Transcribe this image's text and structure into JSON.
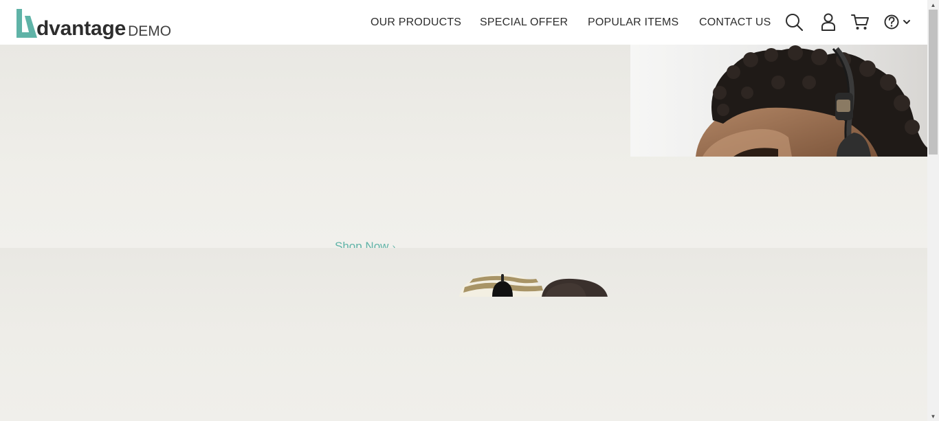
{
  "logo": {
    "word": "dvantage",
    "suffix": "DEMO",
    "mark_icon": "advantage-a-logo",
    "brand_color": "#5fb3a7"
  },
  "nav": {
    "items": [
      {
        "label": "OUR PRODUCTS"
      },
      {
        "label": "SPECIAL OFFER"
      },
      {
        "label": "POPULAR ITEMS"
      },
      {
        "label": "CONTACT US"
      }
    ],
    "icons": [
      "search-icon",
      "user-icon",
      "cart-icon",
      "help-icon",
      "chevron-down-icon"
    ]
  },
  "hero": {
    "cta_label": "Shop Now",
    "cta_icon": "chevron-right-icon",
    "cta_color": "#5fb3a7",
    "image": "man-with-headphones-photo"
  },
  "lower": {
    "image": "wireless-mice-photo"
  },
  "scrollbar": {
    "up_icon": "scroll-up-arrow",
    "down_icon": "scroll-down-arrow"
  }
}
